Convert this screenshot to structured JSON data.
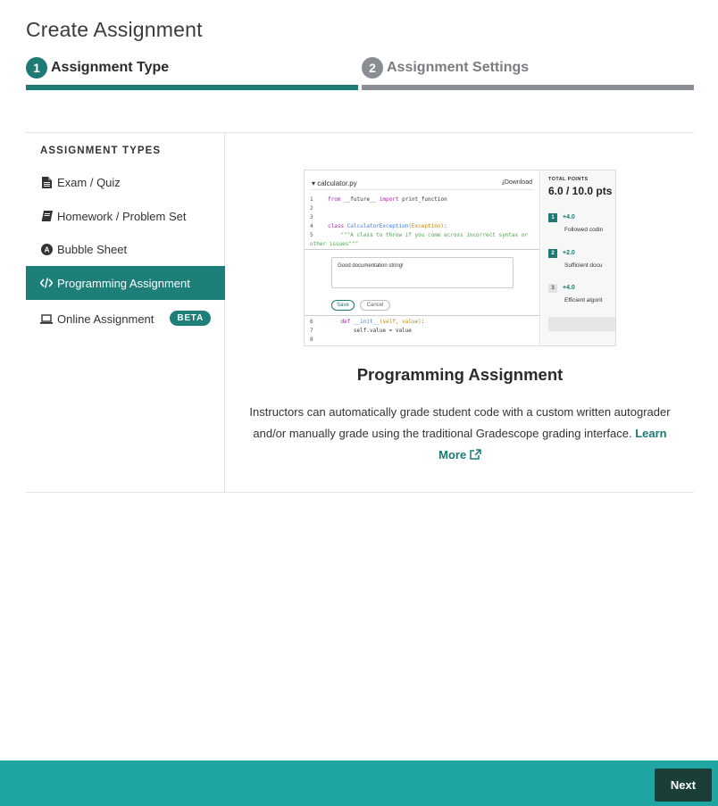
{
  "page": {
    "title": "Create Assignment"
  },
  "steps": [
    {
      "number": "1",
      "label": "Assignment Type"
    },
    {
      "number": "2",
      "label": "Assignment Settings"
    }
  ],
  "sidebar": {
    "heading": "ASSIGNMENT TYPES",
    "items": [
      {
        "label": "Exam / Quiz",
        "icon": "file-icon"
      },
      {
        "label": "Homework / Problem Set",
        "icon": "book-icon"
      },
      {
        "label": "Bubble Sheet",
        "icon": "bubble-a-icon",
        "icon_glyph": "A"
      },
      {
        "label": "Programming Assignment",
        "icon": "code-icon",
        "active": true
      },
      {
        "label": "Online Assignment",
        "icon": "laptop-icon",
        "badge": "BETA"
      }
    ]
  },
  "preview": {
    "filename": "calculator.py",
    "download": "Download",
    "code": {
      "l1_num": "1",
      "l1_kw": "from",
      "l1_rest": " __future__ ",
      "l1_kw2": "import",
      "l1_rest2": " print_function",
      "l2_num": "2",
      "l3_num": "3",
      "l4_num": "4",
      "l4_kw": "class",
      "l4_cls": " CalculatorException",
      "l4_arg": "(Exception)",
      "l4_end": ":",
      "l5_num": "5",
      "l5_str": "    \"\"\"A class to throw if you come across incorrect syntax or",
      "l5b_str": "other issues\"\"\"",
      "l6_num": "6",
      "l6_kw": "    def",
      "l6_fn": " __init__",
      "l6_arg": "(self, value)",
      "l6_end": ":",
      "l7_num": "7",
      "l7_text": "        self.value = value",
      "l8_num": "8"
    },
    "comment": "Good documentation string!",
    "save": "Save",
    "cancel": "Cancel",
    "total_points_label": "TOTAL POINTS",
    "total_points_value": "6.0 / 10.0 pts",
    "rubric": [
      {
        "number": "1",
        "points": "+4.0",
        "desc": "Followed codin"
      },
      {
        "number": "2",
        "points": "+2.0",
        "desc": "Sufficient docu"
      },
      {
        "number": "3",
        "points": "+4.0",
        "desc": "Efficient algorit"
      }
    ]
  },
  "detail": {
    "title": "Programming Assignment",
    "description": "Instructors can automatically grade student code with a custom written autograder and/or manually grade using the traditional Gradescope grading interface.",
    "learn_more": "Learn More"
  },
  "footer": {
    "next": "Next"
  },
  "colors": {
    "accent": "#1d7a74",
    "footer_bg": "#1fa6a2",
    "next_bg": "#1b3e38",
    "inactive": "#8a8d91"
  }
}
